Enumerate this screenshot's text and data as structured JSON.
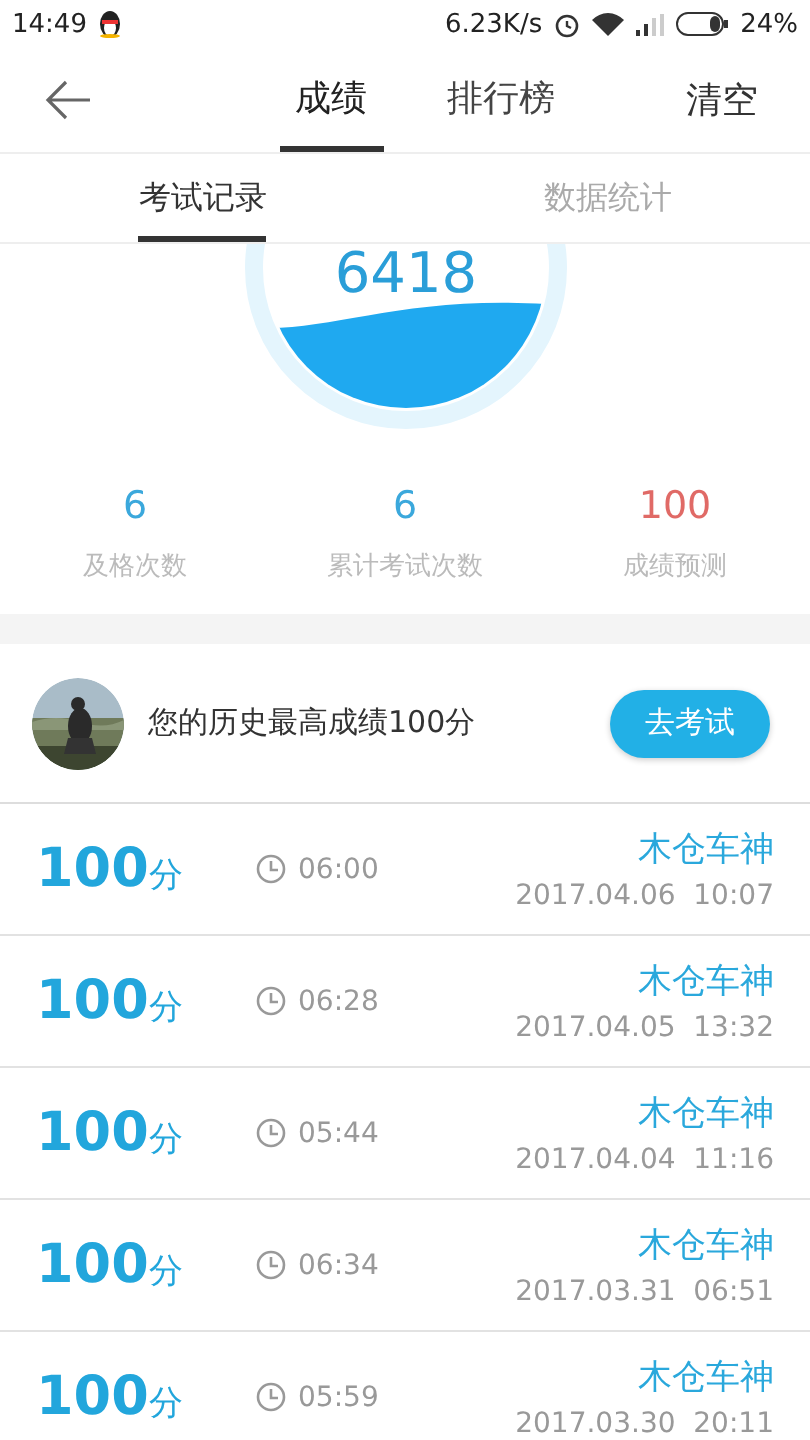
{
  "status_bar": {
    "time": "14:49",
    "speed": "6.23K/s",
    "battery": "24%"
  },
  "header": {
    "tabs": [
      {
        "label": "成绩",
        "selected": true
      },
      {
        "label": "排行榜",
        "selected": false
      }
    ],
    "action": "清空"
  },
  "sub_tabs": [
    {
      "label": "考试记录",
      "selected": true
    },
    {
      "label": "数据统计",
      "selected": false
    }
  ],
  "gauge": {
    "value": "6418"
  },
  "stats": [
    {
      "value": "6",
      "label": "及格次数",
      "color": "#3ba8dc"
    },
    {
      "value": "6",
      "label": "累计考试次数",
      "color": "#3ba8dc"
    },
    {
      "value": "100",
      "label": "成绩预测",
      "color": "#e06a66"
    }
  ],
  "best": {
    "text": "您的历史最高成绩100分",
    "button": "去考试"
  },
  "records": [
    {
      "score": "100",
      "unit": "分",
      "duration": "06:00",
      "name": "木仓车神",
      "datetime": "2017.04.06  10:07"
    },
    {
      "score": "100",
      "unit": "分",
      "duration": "06:28",
      "name": "木仓车神",
      "datetime": "2017.04.05  13:32"
    },
    {
      "score": "100",
      "unit": "分",
      "duration": "05:44",
      "name": "木仓车神",
      "datetime": "2017.04.04  11:16"
    },
    {
      "score": "100",
      "unit": "分",
      "duration": "06:34",
      "name": "木仓车神",
      "datetime": "2017.03.31  06:51"
    },
    {
      "score": "100",
      "unit": "分",
      "duration": "05:59",
      "name": "木仓车神",
      "datetime": "2017.03.30  20:11"
    }
  ]
}
